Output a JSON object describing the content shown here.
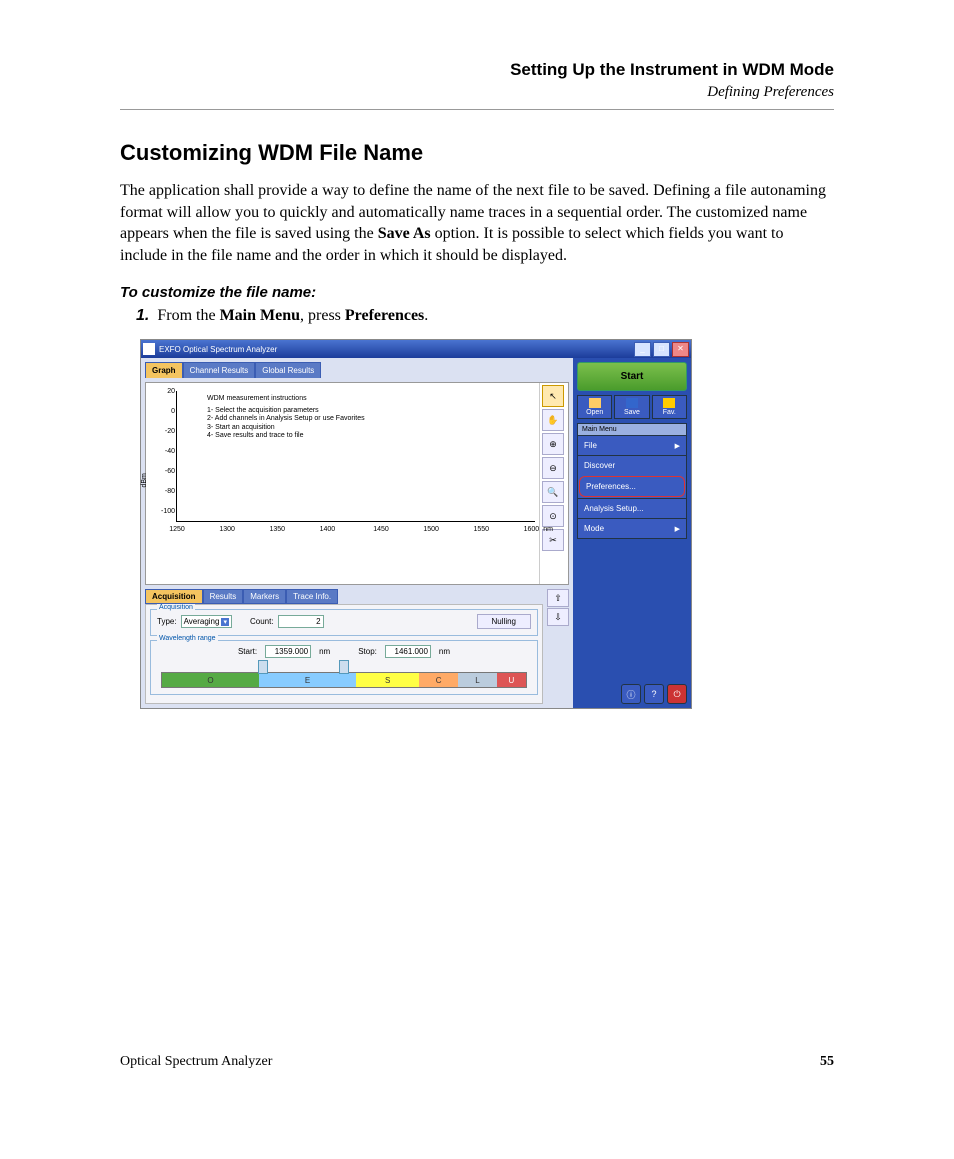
{
  "header": {
    "chapter": "Setting Up the Instrument in WDM Mode",
    "section": "Defining Preferences"
  },
  "heading": "Customizing WDM File Name",
  "paragraph_parts": {
    "p1": "The application shall provide a way to define the name of the next file to be saved. Defining a file autonaming format will allow you to quickly and automatically name traces in a sequential order. The customized name appears when the file is saved using the ",
    "p1_bold": "Save As",
    "p1_end": " option. It is possible to select which fields you want to include in the file name and the order in which it should be displayed."
  },
  "subheading": "To customize the file name:",
  "step1": {
    "num": "1.",
    "pre": "From the ",
    "b1": "Main Menu",
    "mid": ", press ",
    "b2": "Preferences",
    "end": "."
  },
  "shot": {
    "title": "EXFO Optical Spectrum Analyzer",
    "tabs": {
      "graph": "Graph",
      "channel": "Channel Results",
      "global": "Global Results"
    },
    "ylabel": "dBm",
    "yticks": [
      "20",
      "0",
      "-20",
      "-40",
      "-60",
      "-80",
      "-100"
    ],
    "xticks": [
      "1250",
      "1300",
      "1350",
      "1400",
      "1450",
      "1500",
      "1550",
      "1600"
    ],
    "xunit": "nm",
    "instr": {
      "title": "WDM measurement instructions",
      "l1": "1- Select the acquisition parameters",
      "l2": "2- Add channels in Analysis Setup or use Favorites",
      "l3": "3- Start an acquisition",
      "l4": "4- Save results and trace to file"
    },
    "start": "Start",
    "filebtns": {
      "open": "Open",
      "save": "Save",
      "fav": "Fav."
    },
    "menuheader": "Main Menu",
    "menu": {
      "file": "File",
      "discover": "Discover",
      "prefs": "Preferences...",
      "analysis": "Analysis Setup...",
      "mode": "Mode"
    },
    "btabs": {
      "acq": "Acquisition",
      "results": "Results",
      "markers": "Markers",
      "trace": "Trace Info."
    },
    "acq": {
      "legend": "Acquisition",
      "type_label": "Type:",
      "type_val": "Averaging",
      "count_label": "Count:",
      "count_val": "2",
      "nulling": "Nulling"
    },
    "range": {
      "legend": "Wavelength range",
      "start_label": "Start:",
      "start_val": "1359.000",
      "unit": "nm",
      "stop_label": "Stop:",
      "stop_val": "1461.000"
    },
    "bands": {
      "O": "O",
      "E": "E",
      "S": "S",
      "C": "C",
      "L": "L",
      "U": "U"
    }
  },
  "footer": {
    "left": "Optical Spectrum Analyzer",
    "right": "55"
  }
}
